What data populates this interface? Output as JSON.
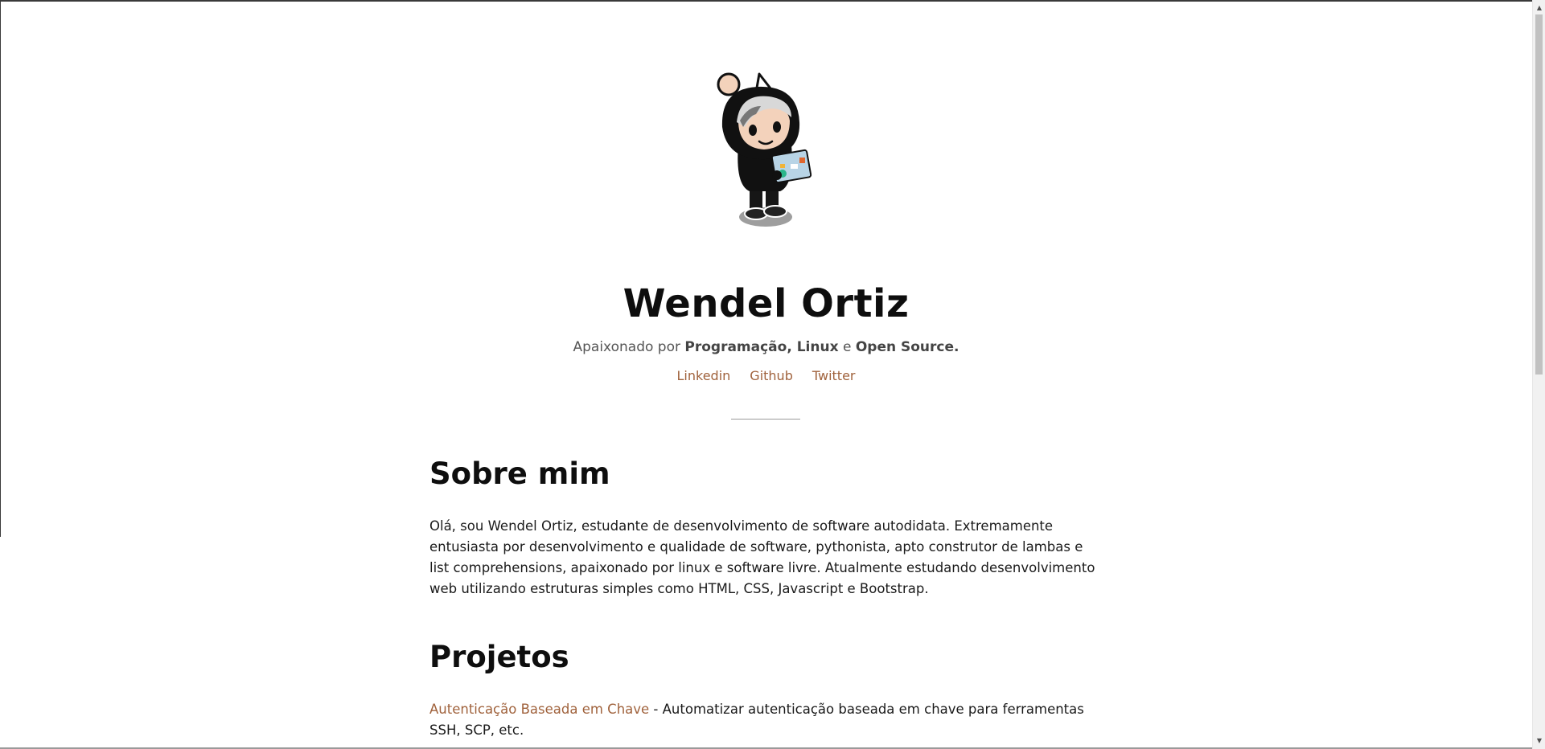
{
  "profile": {
    "name": "Wendel Ortiz",
    "tagline_prefix": "Apaixonado por ",
    "tagline_bold1": "Programação, Linux",
    "tagline_mid": " e ",
    "tagline_bold2": "Open Source."
  },
  "social_links": [
    {
      "label": "Linkedin"
    },
    {
      "label": "Github"
    },
    {
      "label": "Twitter"
    }
  ],
  "about": {
    "title": "Sobre mim",
    "text": "Olá, sou Wendel Ortiz, estudante de desenvolvimento de software autodidata. Extremamente entusiasta por desenvolvimento e qualidade de software, pythonista, apto construtor de lambas e list comprehensions, apaixonado por linux e software livre. Atualmente estudando desenvolvimento web utilizando estruturas simples como HTML, CSS, Javascript e Bootstrap."
  },
  "projects": {
    "title": "Projetos",
    "items": [
      {
        "link": "Autenticação Baseada em Chave",
        "description": " - Automatizar autenticação baseada em chave para ferramentas SSH, SCP, etc."
      }
    ]
  },
  "colors": {
    "link": "#a0623c",
    "heading": "#0e0e0e",
    "text": "#1a1a1a"
  },
  "icons": {
    "avatar": "snoo-avatar-with-laptop"
  }
}
